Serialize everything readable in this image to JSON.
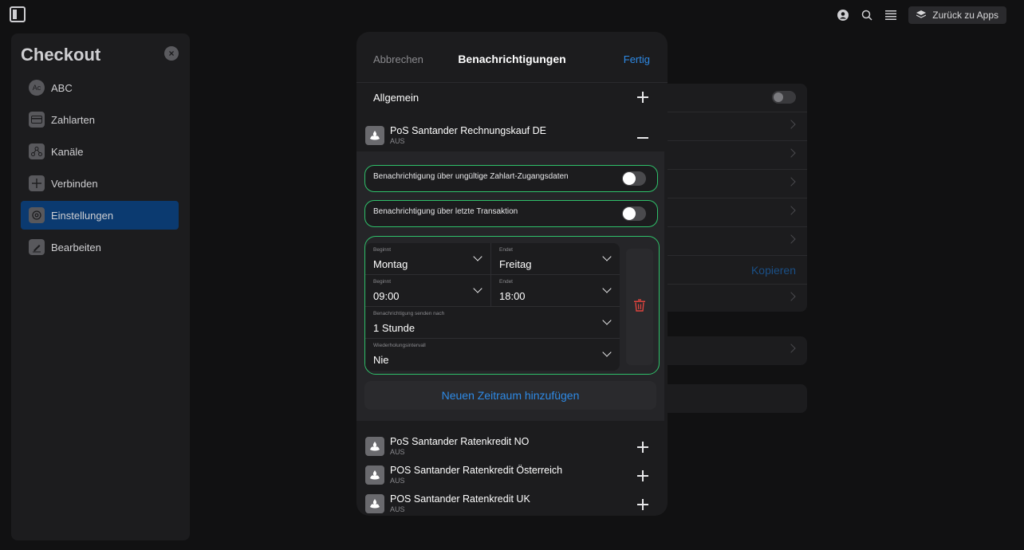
{
  "topbar": {
    "back_label": "Zurück zu Apps",
    "icons": [
      "sidebar-toggle-icon",
      "user-icon",
      "search-icon",
      "menu-icon",
      "apps-icon"
    ]
  },
  "sidebar": {
    "title": "Checkout",
    "items": [
      {
        "label": "ABC",
        "icon": "ac-icon",
        "icon_text": "Ac"
      },
      {
        "label": "Zahlarten",
        "icon": "card-icon"
      },
      {
        "label": "Kanäle",
        "icon": "channels-icon"
      },
      {
        "label": "Verbinden",
        "icon": "plus-icon"
      },
      {
        "label": "Einstellungen",
        "icon": "gear-icon",
        "active": true
      },
      {
        "label": "Bearbeiten",
        "icon": "edit-icon"
      }
    ]
  },
  "background": {
    "copy_label": "Kopieren"
  },
  "modal": {
    "cancel_label": "Abbrechen",
    "title": "Benachrichtigungen",
    "done_label": "Fertig",
    "general_label": "Allgemein",
    "expanded_method": {
      "name": "PoS Santander Rechnungskauf DE",
      "status": "AUS"
    },
    "notifications": [
      {
        "label": "Benachrichtigung über ungültige Zahlart-Zugangsdaten",
        "enabled": false
      },
      {
        "label": "Benachrichtigung über letzte Transaktion",
        "enabled": false
      }
    ],
    "schedule": {
      "start_day": {
        "caption": "Beginnt",
        "value": "Montag"
      },
      "end_day": {
        "caption": "Endet",
        "value": "Freitag"
      },
      "start_time": {
        "caption": "Beginnt",
        "value": "09:00"
      },
      "end_time": {
        "caption": "Endet",
        "value": "18:00"
      },
      "send_after": {
        "caption": "Benachrichtigung senden nach",
        "value": "1 Stunde"
      },
      "repeat": {
        "caption": "Wiederholungsintervall",
        "value": "Nie"
      }
    },
    "add_period_label": "Neuen Zeitraum hinzufügen",
    "collapsed_methods": [
      {
        "name": "PoS Santander Ratenkredit NO",
        "status": "AUS"
      },
      {
        "name": "POS Santander Ratenkredit Österreich",
        "status": "AUS"
      },
      {
        "name": "POS Santander Ratenkredit UK",
        "status": "AUS"
      }
    ]
  },
  "colors": {
    "accent": "#2e8ae6",
    "highlight": "#2fc06a",
    "danger": "#e0443e",
    "active_nav": "#0b3a70"
  }
}
